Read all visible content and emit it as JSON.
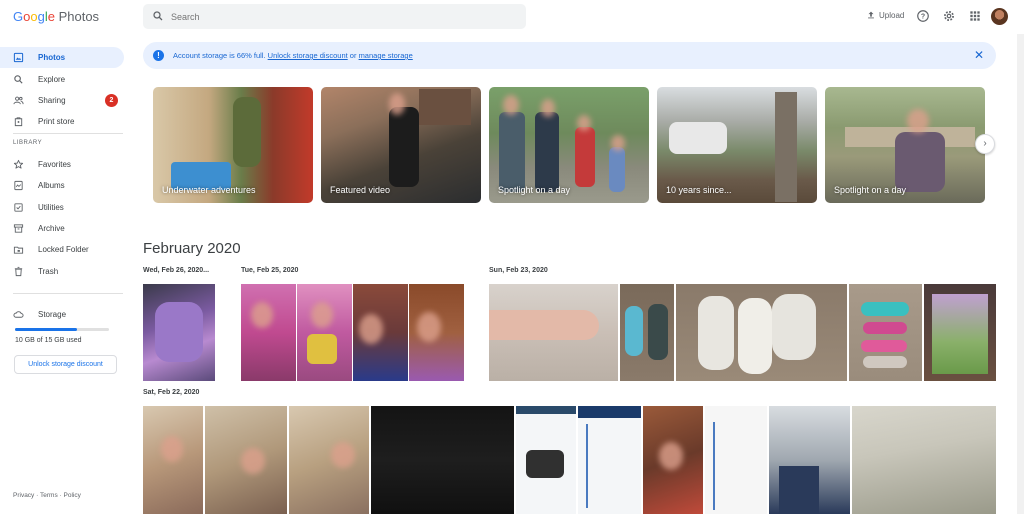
{
  "app": {
    "logo_google": [
      "G",
      "o",
      "o",
      "g",
      "l",
      "e"
    ],
    "logo_product": "Photos"
  },
  "search": {
    "placeholder": "Search"
  },
  "header": {
    "upload_label": "Upload",
    "icons": [
      "help-icon",
      "settings-icon",
      "apps-icon",
      "avatar"
    ]
  },
  "sidebar": {
    "items": [
      {
        "label": "Photos",
        "icon": "photos-icon",
        "active": true
      },
      {
        "label": "Explore",
        "icon": "search-icon"
      },
      {
        "label": "Sharing",
        "icon": "people-icon",
        "badge": "2"
      },
      {
        "label": "Print store",
        "icon": "print-store-icon"
      }
    ],
    "library_header": "LIBRARY",
    "library_items": [
      {
        "label": "Favorites",
        "icon": "star-icon"
      },
      {
        "label": "Albums",
        "icon": "album-icon"
      },
      {
        "label": "Utilities",
        "icon": "utilities-icon"
      },
      {
        "label": "Archive",
        "icon": "archive-icon"
      },
      {
        "label": "Locked Folder",
        "icon": "lock-icon"
      },
      {
        "label": "Trash",
        "icon": "trash-icon"
      }
    ],
    "storage": {
      "label": "Storage",
      "usage_text": "10 GB of 15 GB used",
      "used_fraction": 0.66,
      "unlock_button": "Unlock storage discount"
    },
    "footer": {
      "privacy": "Privacy",
      "terms": "Terms",
      "policy": "Policy",
      "sep": "·"
    }
  },
  "banner": {
    "text_prefix": "Account storage is 66% full.",
    "link_unlock": "Unlock storage discount",
    "text_or": "or",
    "link_manage": "manage storage"
  },
  "memories": [
    {
      "caption": "Underwater adventures"
    },
    {
      "caption": "Featured video"
    },
    {
      "caption": "Spotlight on a day"
    },
    {
      "caption": "10 years since..."
    },
    {
      "caption": "Spotlight on a day"
    }
  ],
  "grid": {
    "month": "February 2020",
    "dates": [
      "Wed, Feb 26, 2020...",
      "Tue, Feb 25, 2020",
      "Sun, Feb 23, 2020",
      "Sat, Feb 22, 2020"
    ]
  },
  "colors": {
    "accent": "#1a73e8",
    "active_bg": "#e8f0fe",
    "badge": "#d93025"
  }
}
